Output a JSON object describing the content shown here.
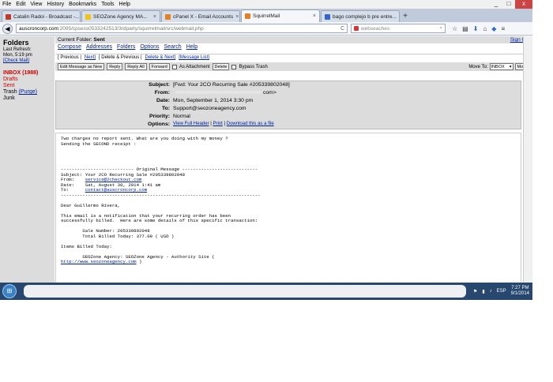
{
  "browser": {
    "menu": [
      "File",
      "Edit",
      "View",
      "History",
      "Bookmarks",
      "Tools",
      "Help"
    ],
    "tabs": [
      {
        "label": "Catalin Radoi - Broadcast -...",
        "color": "#c0392b"
      },
      {
        "label": "SEOZone Agency MA...",
        "color": "#f1c40f"
      },
      {
        "label": "cPanel X - Email Accounts",
        "color": "#e67e22"
      },
      {
        "label": "SquirrelMail",
        "color": "#e67e22",
        "active": true
      },
      {
        "label": "bago complejo b pre entre...",
        "color": "#3366cc"
      }
    ],
    "new_tab": "+",
    "url_host": "auscroncorp.com",
    "url_rest": ":2095/cpsess0533242513/3rdparty/squirrelmail/src/webmail.php",
    "url_refresh": "C",
    "search_placeholder": "webseaches",
    "win_min": "_",
    "win_max": "□",
    "win_close": "x"
  },
  "sidebar": {
    "title": "Folders",
    "last_refresh": "Last Refresh:",
    "refresh_time": "Mon, 5:19 pm",
    "check_mail": "[Check Mail]",
    "inbox": "INBOX (1988)",
    "drafts": "Drafts",
    "sent": "Sent",
    "trash": "Trash",
    "purge": "(Purge)",
    "junk": "Junk"
  },
  "topbar": {
    "current_folder": "Current Folder:",
    "folder_name": "Sent",
    "sign_out": "Sign Out"
  },
  "menu": [
    "Compose",
    "Addresses",
    "Folders",
    "Options",
    "Search",
    "Help"
  ],
  "nav_row": {
    "prev": "[ Previous |",
    "next": "Next]",
    "delete_prev": "[ Delete & Previous |",
    "delete_next": "Delete & Next]",
    "message_list": "[Message List]"
  },
  "toolbar": {
    "edit": "Edit Message as New",
    "reply": "Reply",
    "reply_all": "Reply All",
    "forward": "Forward",
    "as_attachment": "As Attachment",
    "delete": "Delete",
    "bypass_trash": "Bypass Trash",
    "move_to": "Move To:",
    "move_folder": "INBOX",
    "move_btn": "Move"
  },
  "headers": {
    "subject_label": "Subject:",
    "subject": "[Fwd: Your 2CO Recurring Sale #205339802048]",
    "from_label": "From:",
    "from_suffix": "com>",
    "date_label": "Date:",
    "date": "Mon, September 1, 2014 3:30 pm",
    "to_label": "To:",
    "to": "Support@seozoneagency.com",
    "priority_label": "Priority:",
    "priority": "Normal",
    "options_label": "Options:",
    "view_full": "View Full Header",
    "sep1": "|",
    "print": "Print",
    "sep2": "|",
    "download": "Download this as a file"
  },
  "body": {
    "l1": "Two charges no report sent. What are you doing with my money ?",
    "l2": "Sending the SECOND receipt :",
    "l3": "--------------------------- Original Message ----------------------------",
    "l4": "Subject: Your 2CO Recurring Sale #205339802048",
    "l5": "From:    ",
    "l5link": "service@2checkout.com",
    "l6": "Date:    Sat, August 30, 2014 1:41 am",
    "l7": "To:      ",
    "l7link": "contact@auscroncorp.com",
    "l8": "--------------------------------------------------------------------------",
    "l9": "Dear Guillermo Rivera,",
    "l10": "This email is a notification that your recurring order has been",
    "l11": "successfully billed.  Here are some details of this specific transaction:",
    "l12": "        Sale Number: 205339802048",
    "l13": "        Total Billed Today: 377.00 ( USD )",
    "l14": "Items Billed Today:",
    "l15": "        SEOZone Agency: SEOZone Agency - Authority Site (",
    "l16link": "http://www.seozoneagency.com",
    "l16": " )"
  },
  "taskbar": {
    "start": "⊞",
    "lang": "ESP",
    "time": "7:27 PM",
    "date": "9/1/2014"
  }
}
